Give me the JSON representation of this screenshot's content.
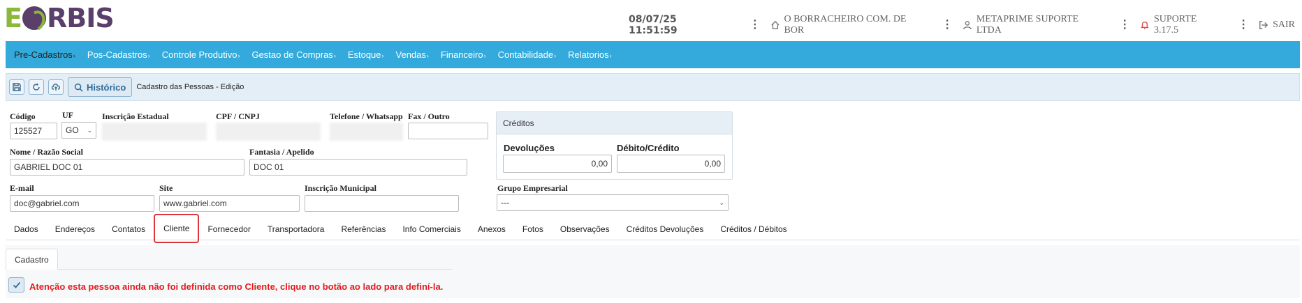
{
  "header": {
    "logo_e": "E",
    "logo_rest": "RBIS",
    "datetime": "08/07/25 11:51:59",
    "company": "O BORRACHEIRO COM. DE BOR",
    "user": "METAPRIME SUPORTE LTDA",
    "support": "SUPORTE 3.17.5",
    "logout": "SAIR",
    "dots": "⋮"
  },
  "nav": {
    "items": [
      {
        "label": "Pre-Cadastros"
      },
      {
        "label": "Pos-Cadastros"
      },
      {
        "label": "Controle Produtivo"
      },
      {
        "label": "Gestao de Compras"
      },
      {
        "label": "Estoque"
      },
      {
        "label": "Vendas"
      },
      {
        "label": "Financeiro"
      },
      {
        "label": "Contabilidade"
      },
      {
        "label": "Relatorios"
      }
    ],
    "arrow": "›"
  },
  "toolbar": {
    "history_label": "Histórico",
    "title": "Cadastro das Pessoas - Edição"
  },
  "form": {
    "codigo_label": "Código",
    "codigo_value": "125527",
    "uf_label": "UF",
    "uf_value": "GO",
    "ie_label": "Inscrição Estadual",
    "cpf_label": "CPF / CNPJ",
    "tel_label": "Telefone / Whatsapp",
    "fax_label": "Fax / Outro",
    "fax_value": "",
    "nome_label": "Nome / Razão Social",
    "nome_value": "GABRIEL DOC 01",
    "fantasia_label": "Fantasia / Apelido",
    "fantasia_value": "DOC 01",
    "email_label": "E-mail",
    "email_value": "doc@gabriel.com",
    "site_label": "Site",
    "site_value": "www.gabriel.com",
    "im_label": "Inscrição Municipal",
    "im_value": "",
    "grupo_label": "Grupo Empresarial",
    "grupo_value": "---"
  },
  "credits": {
    "title": "Créditos",
    "devolucoes_label": "Devoluções",
    "devolucoes_value": "0,00",
    "debito_label": "Débito/Crédito",
    "debito_value": "0,00"
  },
  "tabs": [
    {
      "label": "Dados"
    },
    {
      "label": "Endereços"
    },
    {
      "label": "Contatos"
    },
    {
      "label": "Cliente"
    },
    {
      "label": "Fornecedor"
    },
    {
      "label": "Transportadora"
    },
    {
      "label": "Referências"
    },
    {
      "label": "Info Comerciais"
    },
    {
      "label": "Anexos"
    },
    {
      "label": "Fotos"
    },
    {
      "label": "Observações"
    },
    {
      "label": "Créditos Devoluções"
    },
    {
      "label": "Créditos / Débitos"
    }
  ],
  "subtab_label": "Cadastro",
  "warning": "Atenção esta pessoa ainda não foi definida como Cliente, clique no botão ao lado para definí-la.",
  "colors": {
    "nav_bg": "#33aadb",
    "logo_green": "#8bb83a",
    "logo_purple": "#5a3f6b",
    "warning": "#e41b1b",
    "highlight": "#d9363e"
  }
}
